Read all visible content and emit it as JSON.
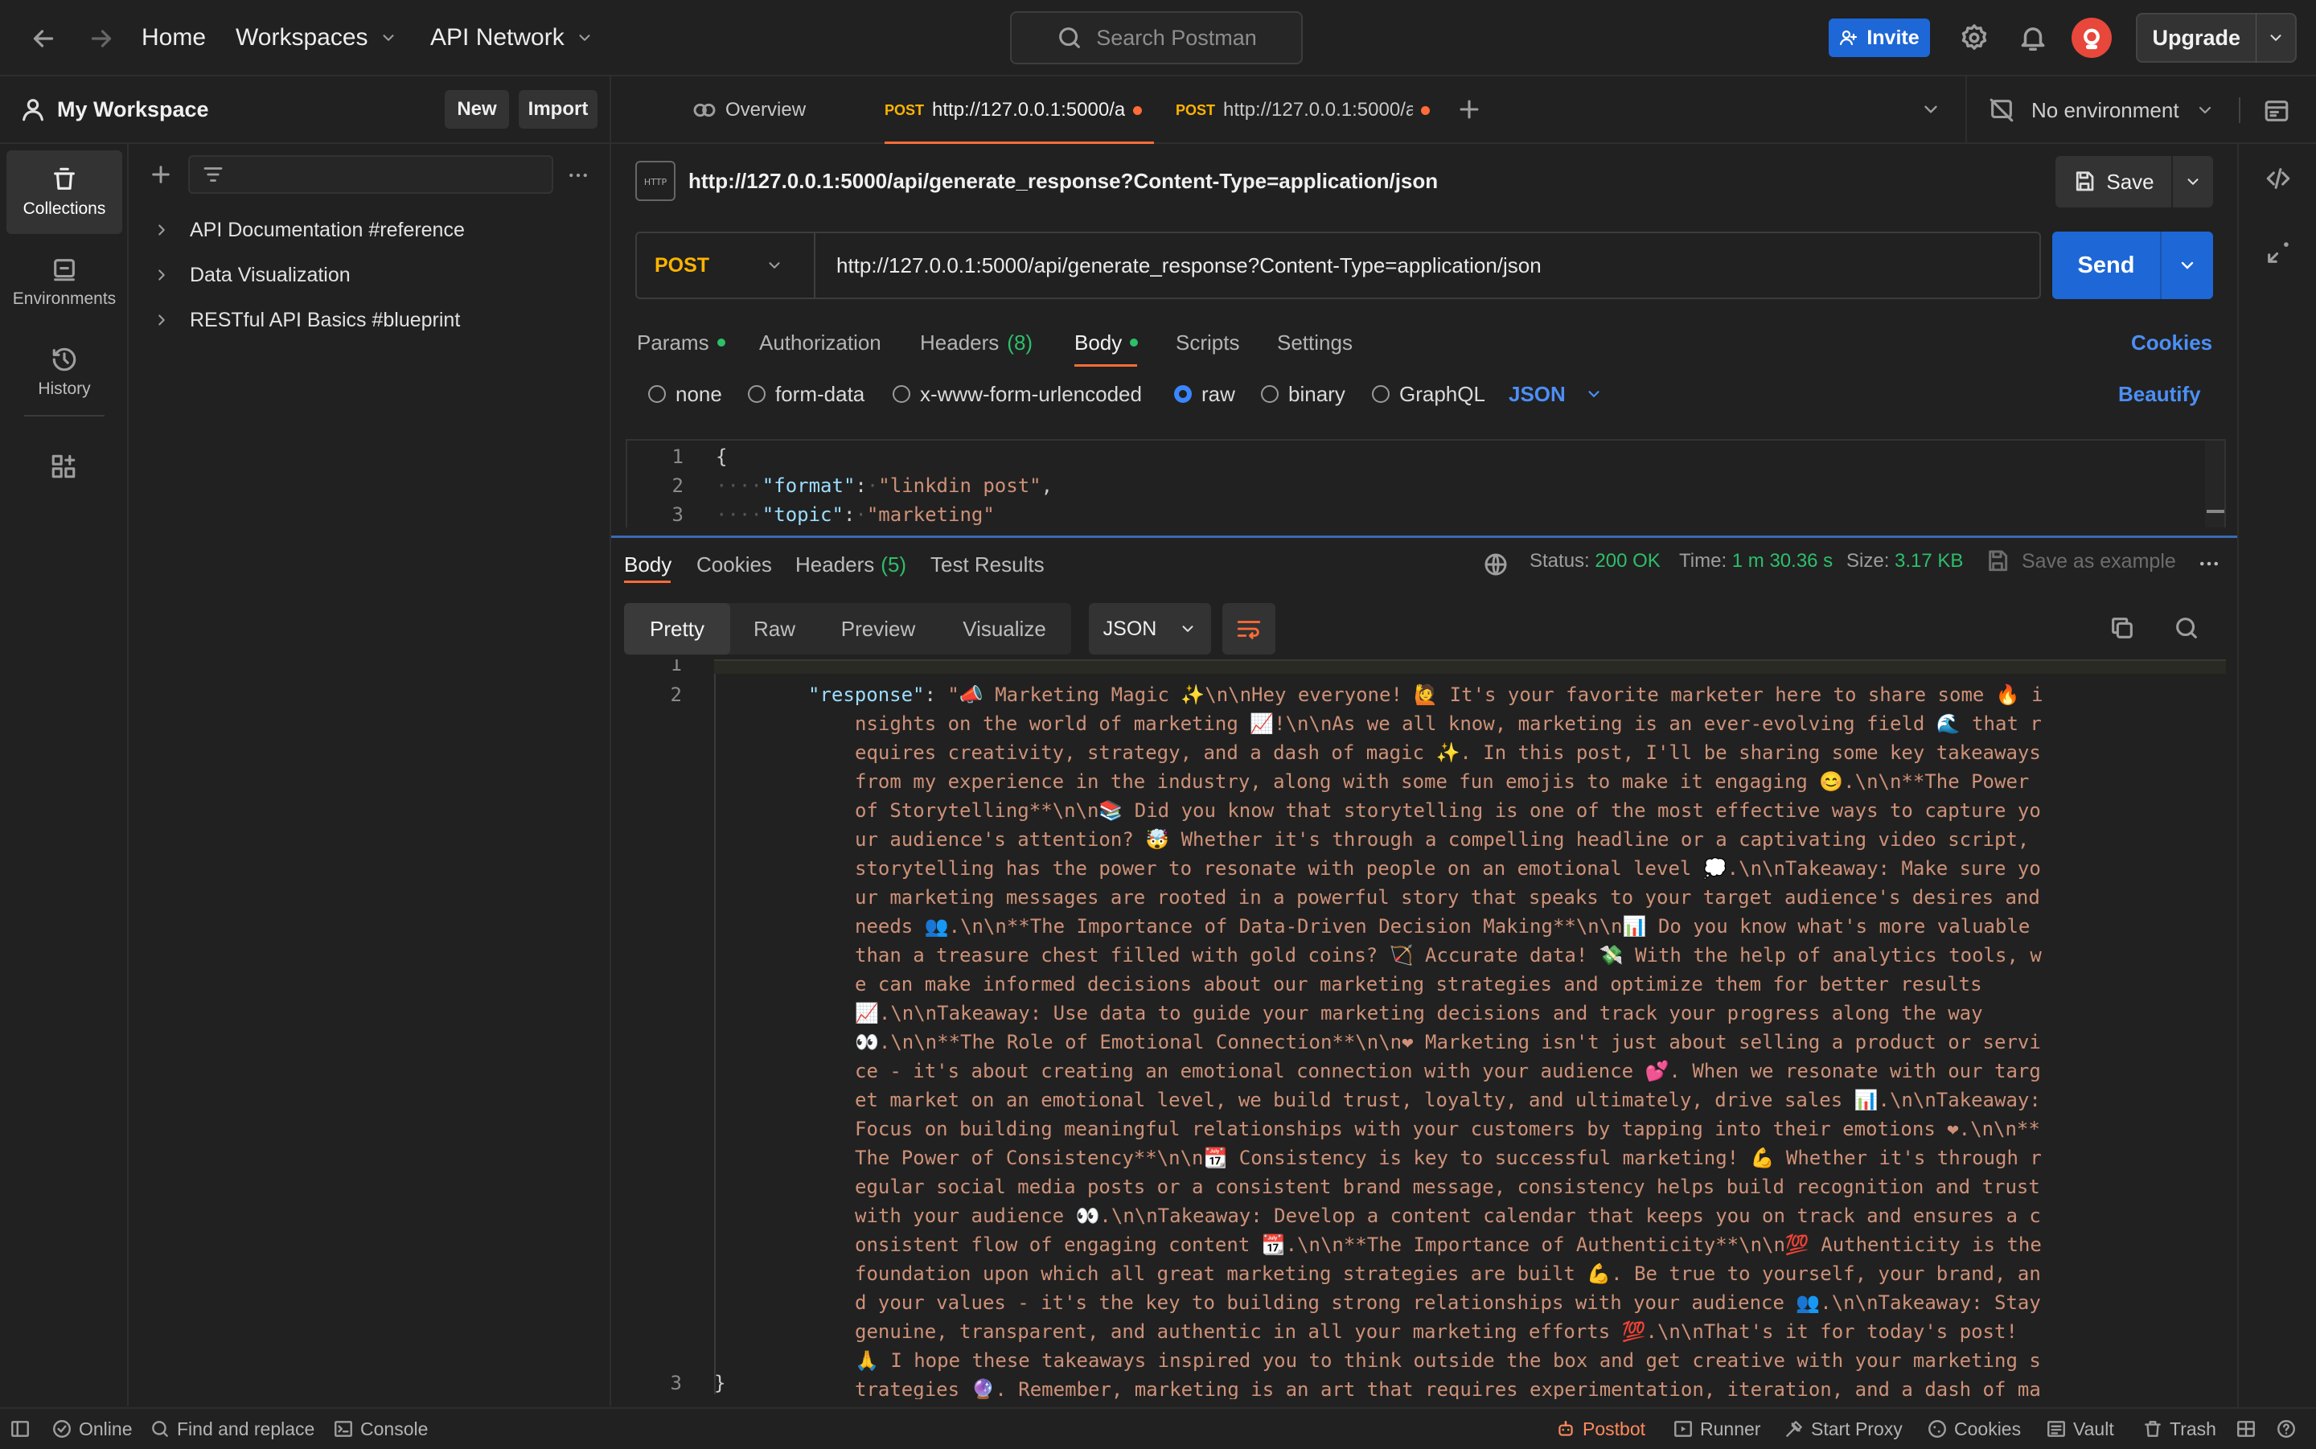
{
  "topbar": {
    "home": "Home",
    "workspaces": "Workspaces",
    "api_network": "API Network",
    "search_placeholder": "Search Postman",
    "invite": "Invite",
    "upgrade": "Upgrade"
  },
  "sidebar": {
    "workspace_name": "My Workspace",
    "new_btn": "New",
    "import_btn": "Import",
    "rail": [
      {
        "label": "Collections",
        "icon": "collections-icon"
      },
      {
        "label": "Environments",
        "icon": "environments-icon"
      },
      {
        "label": "History",
        "icon": "history-icon"
      }
    ],
    "collections": [
      "API Documentation #reference",
      "Data Visualization",
      "RESTful API Basics #blueprint"
    ]
  },
  "tabs": {
    "overview": "Overview",
    "tab1_method": "POST",
    "tab1_title": "http://127.0.0.1:5000/a",
    "tab2_method": "POST",
    "tab2_title": "http://127.0.0.1:5000/a",
    "environment": "No environment"
  },
  "request": {
    "title": "http://127.0.0.1:5000/api/generate_response?Content-Type=application/json",
    "save": "Save",
    "method": "POST",
    "url": "http://127.0.0.1:5000/api/generate_response?Content-Type=application/json",
    "send": "Send",
    "tabs": {
      "params": "Params",
      "authorization": "Authorization",
      "headers": "Headers",
      "headers_count": "(8)",
      "body": "Body",
      "scripts": "Scripts",
      "settings": "Settings"
    },
    "cookies": "Cookies",
    "body_types": [
      "none",
      "form-data",
      "x-www-form-urlencoded",
      "raw",
      "binary",
      "GraphQL"
    ],
    "body_format": "JSON",
    "beautify": "Beautify",
    "editor": {
      "line1": "{",
      "line2_key": "\"format\"",
      "line2_val": "\"linkdin post\"",
      "line3_key": "\"topic\"",
      "line3_val": "\"marketing\""
    }
  },
  "response": {
    "tabs": {
      "body": "Body",
      "cookies": "Cookies",
      "headers": "Headers",
      "headers_count": "(5)",
      "test_results": "Test Results"
    },
    "status_label": "Status:",
    "status_value": "200 OK",
    "time_label": "Time:",
    "time_value": "1 m 30.36 s",
    "size_label": "Size:",
    "size_value": "3.17 KB",
    "save_example": "Save as example",
    "views": [
      "Pretty",
      "Raw",
      "Preview",
      "Visualize"
    ],
    "format": "JSON",
    "line_numbers": [
      "1",
      "2",
      "3"
    ],
    "key": "\"response\"",
    "value": "\"📣 Marketing Magic ✨\\n\\nHey everyone! 🙋 It's your favorite marketer here to share some 🔥 insights on the world of marketing 📈!\\n\\nAs we all know, marketing is an ever-evolving field 🌊 that requires creativity, strategy, and a dash of magic ✨. In this post, I'll be sharing some key takeaways from my experience in the industry, along with some fun emojis to make it engaging 😊.\\n\\n**The Power of Storytelling**\\n\\n📚 Did you know that storytelling is one of the most effective ways to capture your audience's attention? 🤯 Whether it's through a compelling headline or a captivating video script, storytelling has the power to resonate with people on an emotional level 💭.\\n\\nTakeaway: Make sure your marketing messages are rooted in a powerful story that speaks to your target audience's desires and needs 👥.\\n\\n**The Importance of Data-Driven Decision Making**\\n\\n📊 Do you know what's more valuable than a treasure chest filled with gold coins? 🏹 Accurate data! 💸 With the help of analytics tools, we can make informed decisions about our marketing strategies and optimize them for better results 📈.\\n\\nTakeaway: Use data to guide your marketing decisions and track your progress along the way 👀.\\n\\n**The Role of Emotional Connection**\\n\\n❤ Marketing isn't just about selling a product or service - it's about creating an emotional connection with your audience 💕. When we resonate with our target market on an emotional level, we build trust, loyalty, and ultimately, drive sales 📊.\\n\\nTakeaway: Focus on building meaningful relationships with your customers by tapping into their emotions ❤.\\n\\n**The Power of Consistency**\\n\\n📆 Consistency is key to successful marketing! 💪 Whether it's through regular social media posts or a consistent brand message, consistency helps build recognition and trust with your audience 👀.\\n\\nTakeaway: Develop a content calendar that keeps you on track and ensures a consistent flow of engaging content 📆.\\n\\n**The Importance of Authenticity**\\n\\n💯 Authenticity is the foundation upon which all great marketing strategies are built 💪. Be true to yourself, your brand, and your values - it's the key to building strong relationships with your audience 👥.\\n\\nTakeaway: Stay genuine, transparent, and authentic in all your marketing efforts 💯.\\n\\nThat's it for today's post! 🙏 I hope these takeaways inspired you to think outside the box and get creative with your marketing strategies 🔮. Remember, marketing is an art that requires experimentation, iteration, and a dash of magic ✨.\\n\\nWhat are some of your favorite marketing tips or tricks? Share them in the comments below! 💬\\n\\n#marketing #storytelling #dataanalytics #emotionalconnection #consistency #authenticity\"",
    "closing": "}"
  },
  "footer": {
    "online": "Online",
    "find_replace": "Find and replace",
    "console": "Console",
    "postbot": "Postbot",
    "runner": "Runner",
    "start_proxy": "Start Proxy",
    "cookies": "Cookies",
    "vault": "Vault",
    "trash": "Trash"
  },
  "colors": {
    "accent_blue": "#1e67d6",
    "status_green": "#2dbf6a",
    "method_post": "#ffb400",
    "unsaved_dot": "#ff6c37"
  }
}
